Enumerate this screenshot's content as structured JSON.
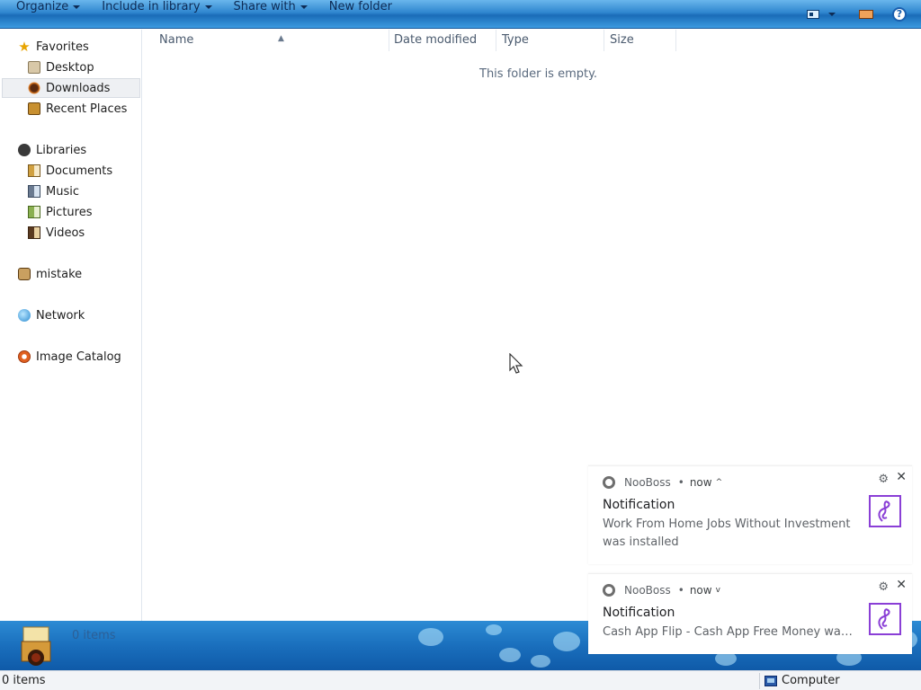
{
  "toolbar": {
    "organize": "Organize",
    "include_in_library": "Include in library",
    "share_with": "Share with",
    "new_folder": "New folder"
  },
  "nav": {
    "favorites": "Favorites",
    "desktop": "Desktop",
    "downloads": "Downloads",
    "recent_places": "Recent Places",
    "libraries": "Libraries",
    "documents": "Documents",
    "music": "Music",
    "pictures": "Pictures",
    "videos": "Videos",
    "user": "mistake",
    "network": "Network",
    "image_catalog": "Image Catalog"
  },
  "columns": {
    "name": "Name",
    "date_modified": "Date modified",
    "type": "Type",
    "size": "Size"
  },
  "content": {
    "empty_message": "This folder is empty."
  },
  "details": {
    "item_count": "0 items"
  },
  "status": {
    "item_count": "0 items",
    "location": "Computer"
  },
  "notifications": [
    {
      "app": "NooBoss",
      "dot": "•",
      "time": "now",
      "chevron": "^",
      "title": "Notification",
      "body": "Work From Home Jobs Without Investment was installed"
    },
    {
      "app": "NooBoss",
      "dot": "•",
      "time": "now",
      "chevron": "v",
      "title": "Notification",
      "body": "Cash App Flip - Cash App Free Money was ..."
    }
  ],
  "colors": {
    "toolbar_blue": "#2f86cf",
    "details_blue": "#1a6fbd",
    "nooboss_purple": "#8a3fd6"
  }
}
